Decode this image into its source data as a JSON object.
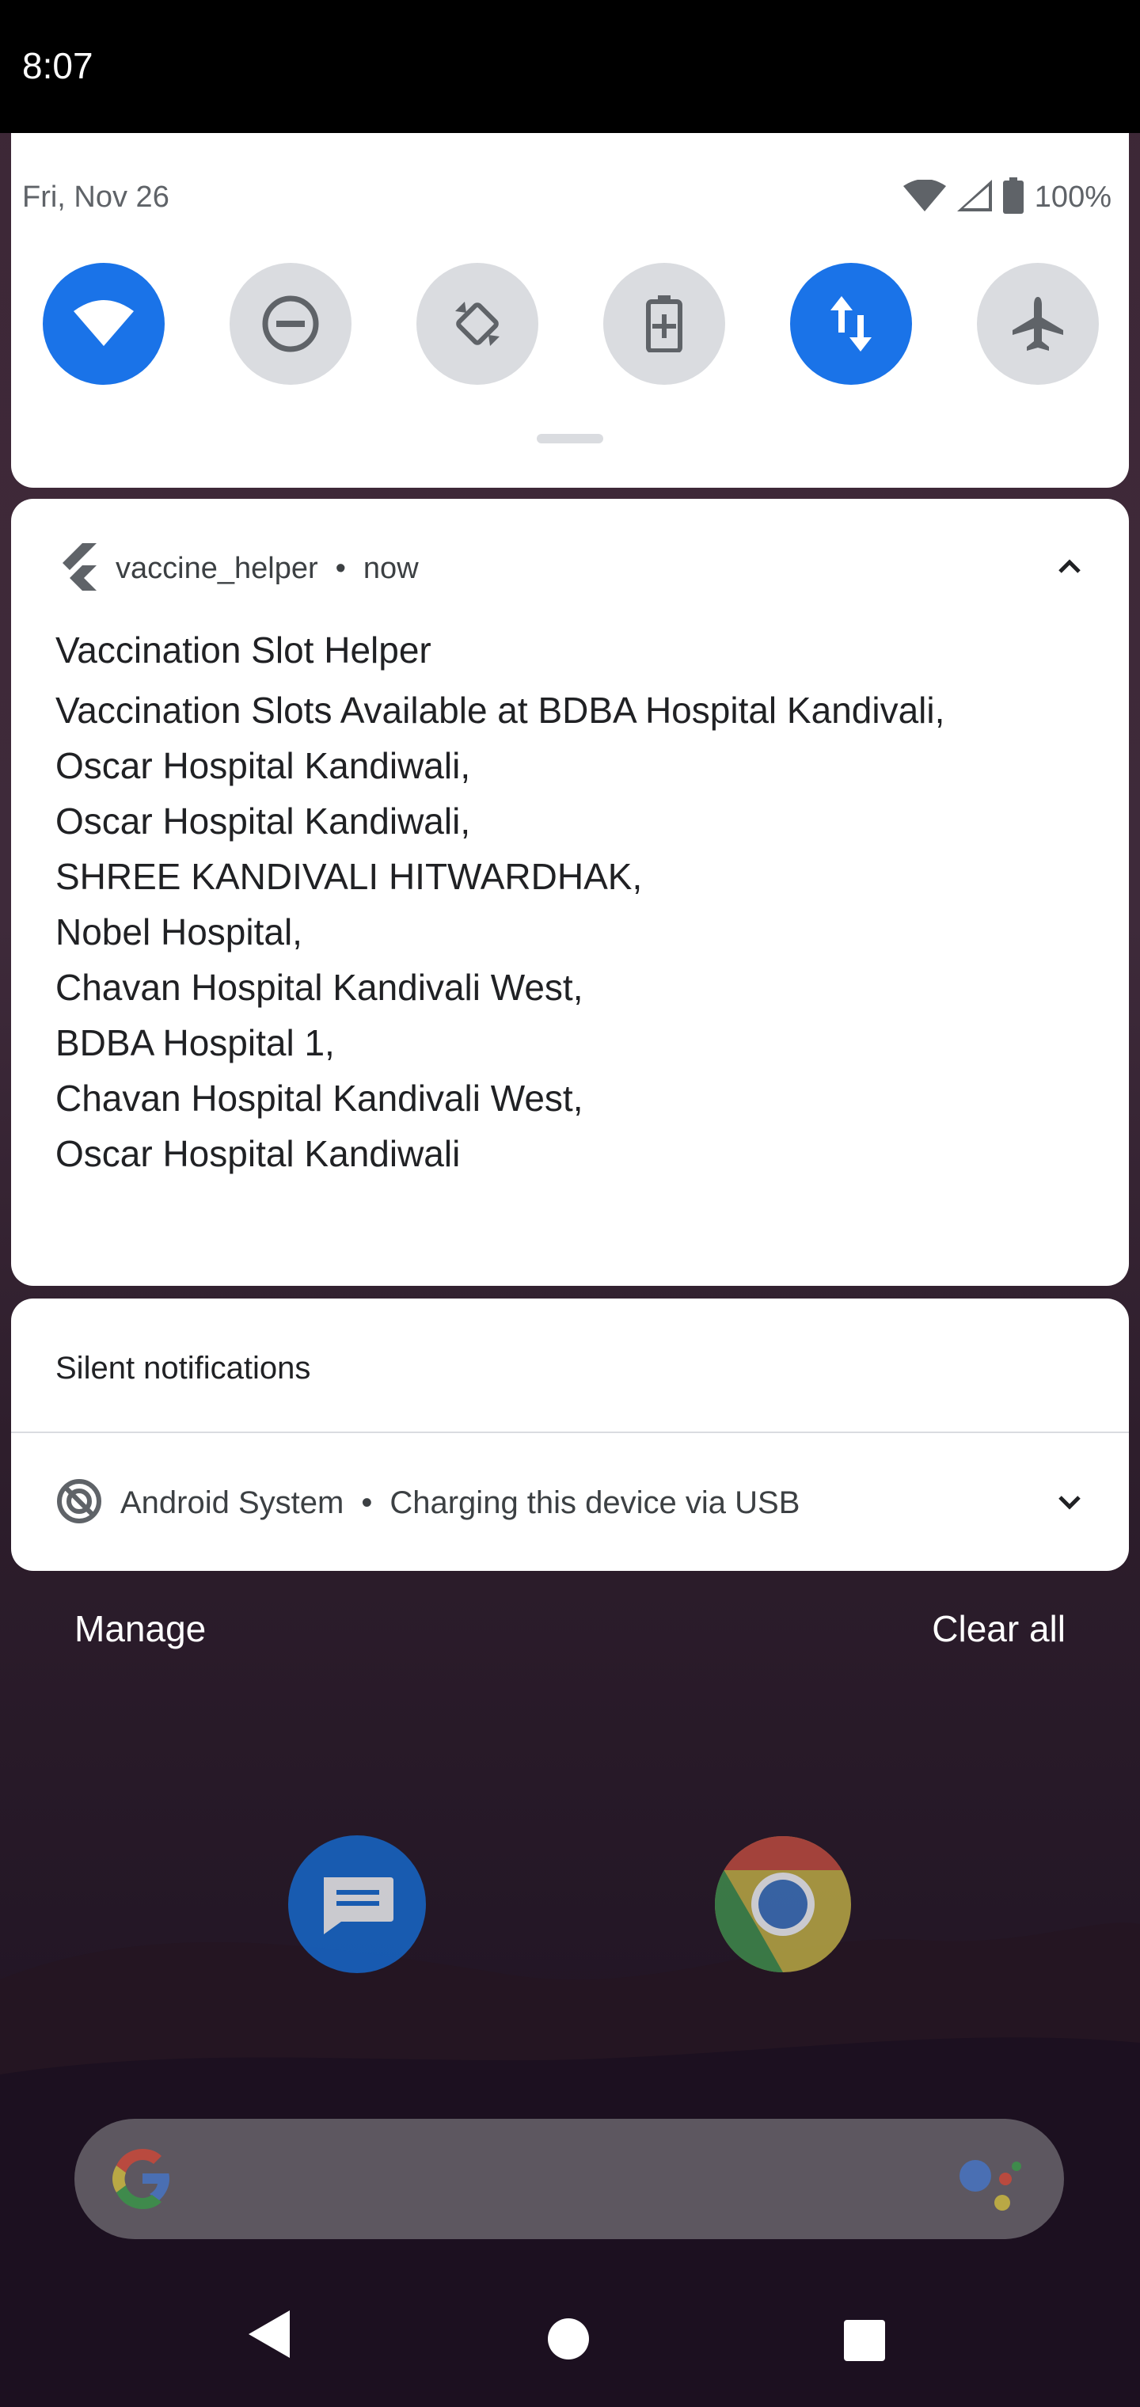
{
  "status_bar": {
    "time": "8:07"
  },
  "quick_settings": {
    "date": "Fri, Nov 26",
    "battery_text": "100%",
    "tiles": [
      {
        "name": "wifi",
        "active": true
      },
      {
        "name": "do-not-disturb",
        "active": false
      },
      {
        "name": "auto-rotate",
        "active": false
      },
      {
        "name": "battery-saver",
        "active": false
      },
      {
        "name": "mobile-data",
        "active": true
      },
      {
        "name": "airplane-mode",
        "active": false
      }
    ],
    "colors": {
      "active": "#1a73e8",
      "inactive": "#dadce0"
    }
  },
  "notification": {
    "app_name": "vaccine_helper",
    "separator": "•",
    "time": "now",
    "title": "Vaccination Slot Helper",
    "lines": [
      "Vaccination Slots Available at BDBA Hospital Kandivali,",
      "Oscar Hospital Kandiwali,",
      "Oscar Hospital Kandiwali,",
      "SHREE KANDIVALI HITWARDHAK,",
      "Nobel Hospital,",
      "Chavan Hospital Kandivali West,",
      "BDBA Hospital 1,",
      "Chavan Hospital Kandivali West,",
      "Oscar Hospital Kandiwali"
    ]
  },
  "silent_section": {
    "header": "Silent notifications",
    "item": {
      "app": "Android System",
      "separator": "•",
      "text": "Charging this device via USB"
    }
  },
  "footer": {
    "manage": "Manage",
    "clear_all": "Clear all"
  },
  "home": {
    "apps": [
      "messages-icon",
      "chrome-icon"
    ],
    "search_bar": {
      "icons": [
        "google-g-icon",
        "assistant-icon"
      ]
    }
  }
}
